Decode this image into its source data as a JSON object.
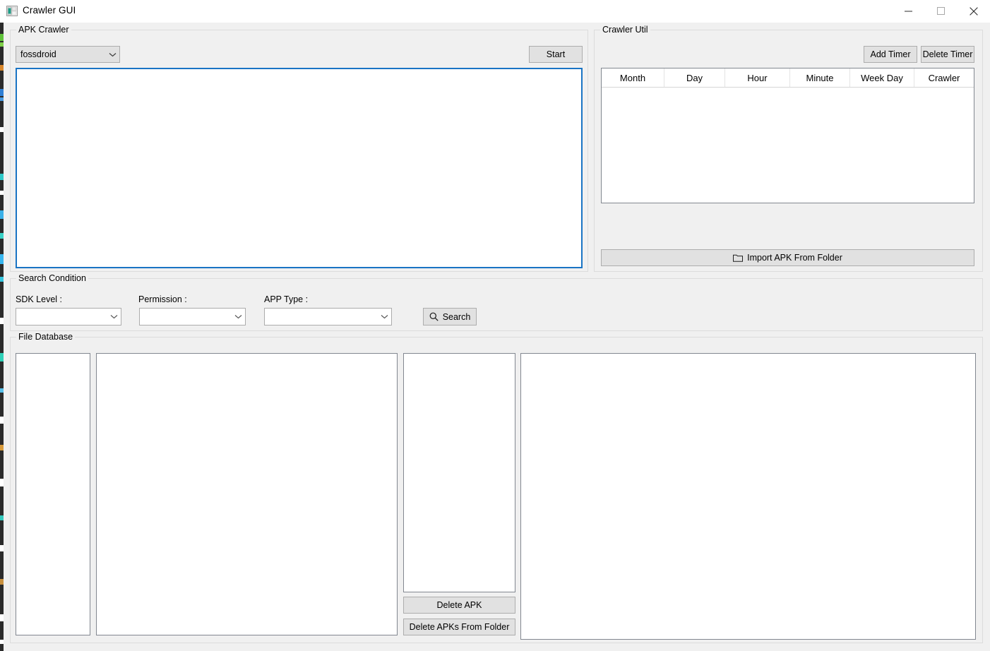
{
  "window": {
    "title": "Crawler GUI",
    "icon": "app-window-icon",
    "controls": {
      "minimize": "minimize-icon",
      "maximize": "maximize-icon",
      "close": "close-icon"
    }
  },
  "apk_crawler": {
    "group_title": "APK Crawler",
    "source_combo": {
      "value": "fossdroid",
      "placeholder": ""
    },
    "start_button": "Start",
    "output_text": ""
  },
  "crawler_util": {
    "group_title": "Crawler Util",
    "add_timer_button": "Add Timer",
    "delete_timer_button": "Delete Timer",
    "table": {
      "columns": [
        "Month",
        "Day",
        "Hour",
        "Minute",
        "Week Day",
        "Crawler"
      ],
      "rows": []
    },
    "import_button": {
      "label": "Import APK From Folder",
      "icon": "folder-icon"
    }
  },
  "search_condition": {
    "group_title": "Search Condition",
    "fields": [
      {
        "label": "SDK Level :",
        "value": "",
        "placeholder": ""
      },
      {
        "label": "Permission :",
        "value": "",
        "placeholder": ""
      },
      {
        "label": "APP Type :",
        "value": "",
        "placeholder": ""
      }
    ],
    "search_button": {
      "label": "Search",
      "icon": "search-icon"
    }
  },
  "file_database": {
    "group_title": "File Database",
    "panels": {
      "list_1": "",
      "list_2": "",
      "list_3": "",
      "detail": ""
    },
    "delete_apk_button": "Delete APK",
    "delete_apks_folder_button": "Delete APKs From Folder"
  },
  "colors": {
    "window_background": "#f0f0f0",
    "title_bar": "#ffffff",
    "focus_border": "#1a74c4",
    "button_face": "#e1e1e1",
    "button_border": "#adadad",
    "panel_border": "#828790",
    "group_border": "#dcdcdc"
  }
}
